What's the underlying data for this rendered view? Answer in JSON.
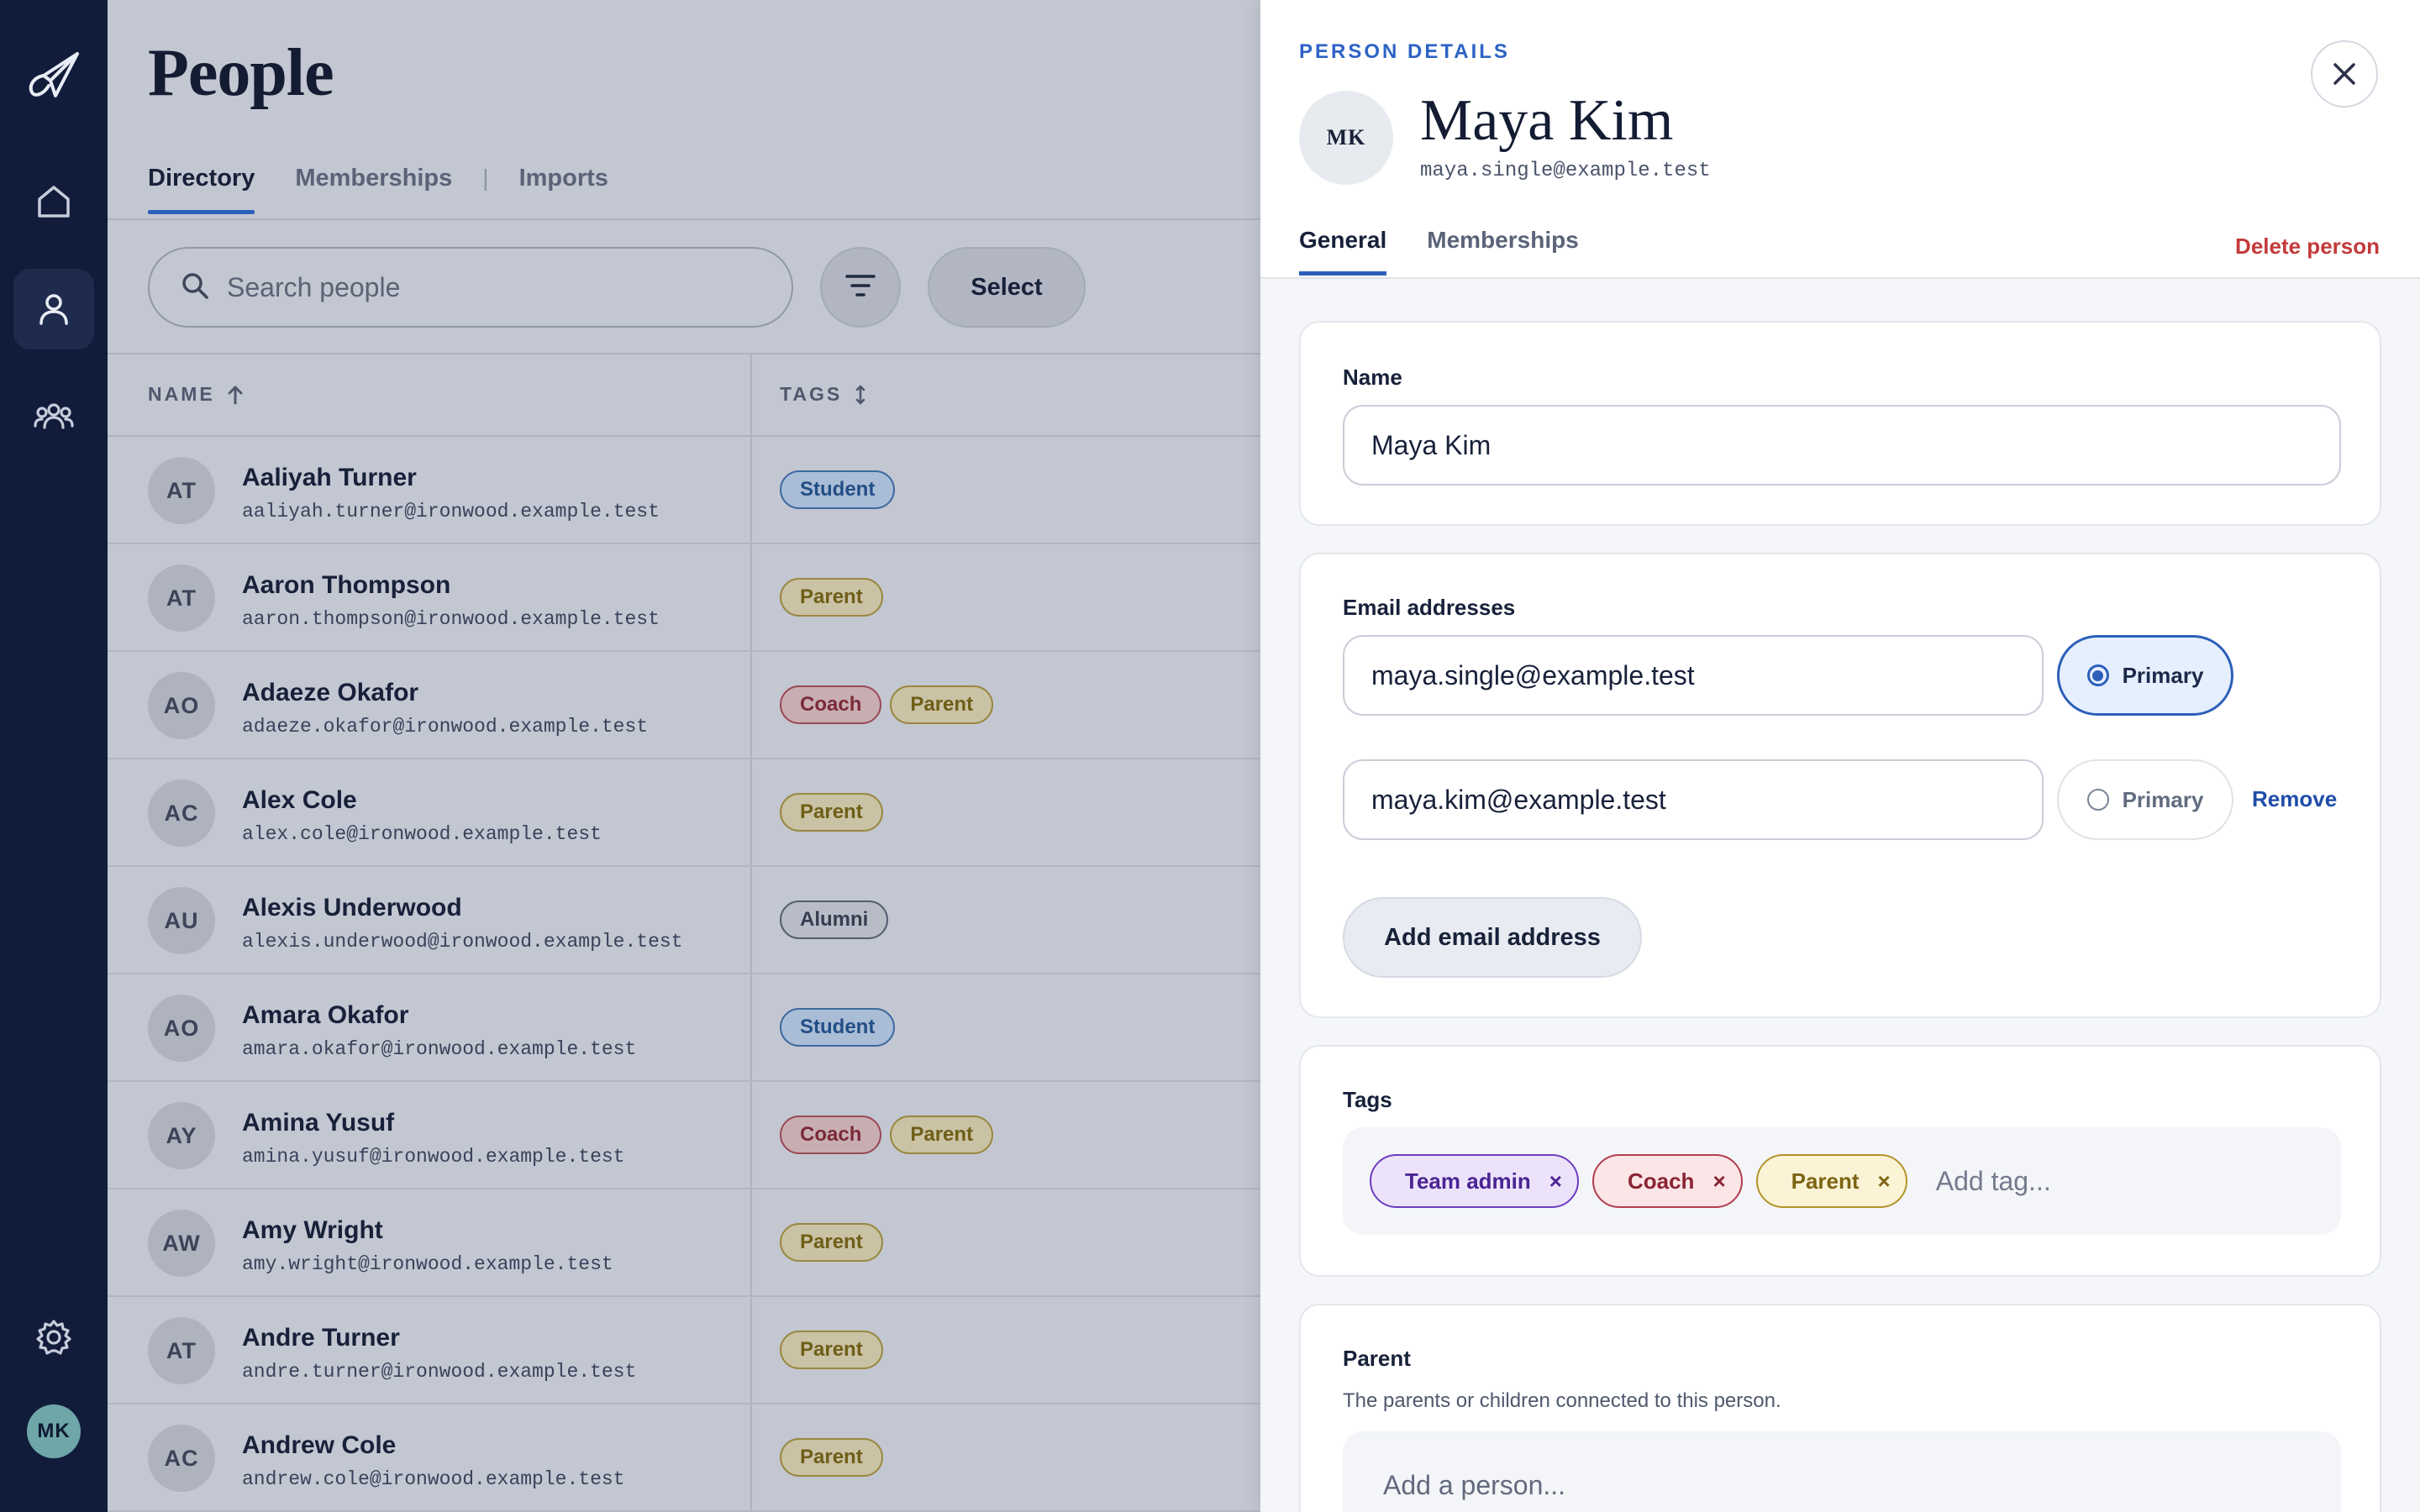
{
  "rail": {
    "icons": [
      "paper-plane-logo",
      "home-icon",
      "person-icon",
      "group-icon",
      "gear-icon"
    ],
    "user_initials": "MK"
  },
  "page": {
    "title": "People",
    "tabs": [
      {
        "label": "Directory",
        "active": true
      },
      {
        "label": "Memberships",
        "active": false
      },
      {
        "label": "Imports",
        "active": false
      }
    ],
    "tab_separator": "|",
    "search_placeholder": "Search people",
    "select_label": "Select"
  },
  "table": {
    "columns": {
      "name": "NAME",
      "tags": "TAGS"
    },
    "rows": [
      {
        "initials": "AT",
        "name": "Aaliyah Turner",
        "email": "aaliyah.turner@ironwood.example.test",
        "tags": [
          "Student"
        ]
      },
      {
        "initials": "AT",
        "name": "Aaron Thompson",
        "email": "aaron.thompson@ironwood.example.test",
        "tags": [
          "Parent"
        ]
      },
      {
        "initials": "AO",
        "name": "Adaeze Okafor",
        "email": "adaeze.okafor@ironwood.example.test",
        "tags": [
          "Coach",
          "Parent"
        ]
      },
      {
        "initials": "AC",
        "name": "Alex Cole",
        "email": "alex.cole@ironwood.example.test",
        "tags": [
          "Parent"
        ]
      },
      {
        "initials": "AU",
        "name": "Alexis Underwood",
        "email": "alexis.underwood@ironwood.example.test",
        "tags": [
          "Alumni"
        ]
      },
      {
        "initials": "AO",
        "name": "Amara Okafor",
        "email": "amara.okafor@ironwood.example.test",
        "tags": [
          "Student"
        ]
      },
      {
        "initials": "AY",
        "name": "Amina Yusuf",
        "email": "amina.yusuf@ironwood.example.test",
        "tags": [
          "Coach",
          "Parent"
        ]
      },
      {
        "initials": "AW",
        "name": "Amy Wright",
        "email": "amy.wright@ironwood.example.test",
        "tags": [
          "Parent"
        ]
      },
      {
        "initials": "AT",
        "name": "Andre Turner",
        "email": "andre.turner@ironwood.example.test",
        "tags": [
          "Parent"
        ]
      },
      {
        "initials": "AC",
        "name": "Andrew Cole",
        "email": "andrew.cole@ironwood.example.test",
        "tags": [
          "Parent"
        ]
      }
    ]
  },
  "drawer": {
    "eyebrow": "PERSON DETAILS",
    "initials": "MK",
    "name": "Maya Kim",
    "email": "maya.single@example.test",
    "tabs": [
      {
        "label": "General",
        "active": true
      },
      {
        "label": "Memberships",
        "active": false
      }
    ],
    "delete_label": "Delete person",
    "name_section": {
      "label": "Name",
      "value": "Maya Kim"
    },
    "email_section": {
      "label": "Email addresses",
      "emails": [
        {
          "value": "maya.single@example.test",
          "primary_label": "Primary",
          "is_primary": true
        },
        {
          "value": "maya.kim@example.test",
          "primary_label": "Primary",
          "is_primary": false,
          "remove_label": "Remove"
        }
      ],
      "add_label": "Add email address"
    },
    "tags_section": {
      "label": "Tags",
      "tags": [
        "Team admin",
        "Coach",
        "Parent"
      ],
      "remove_glyph": "×",
      "input_placeholder": "Add tag..."
    },
    "parent_section": {
      "label": "Parent",
      "help": "The parents or children connected to this person.",
      "input_placeholder": "Add a person..."
    }
  },
  "colors": {
    "rail_bg": "#111c3b",
    "accent": "#2c5fba",
    "danger": "#c33a3a"
  }
}
